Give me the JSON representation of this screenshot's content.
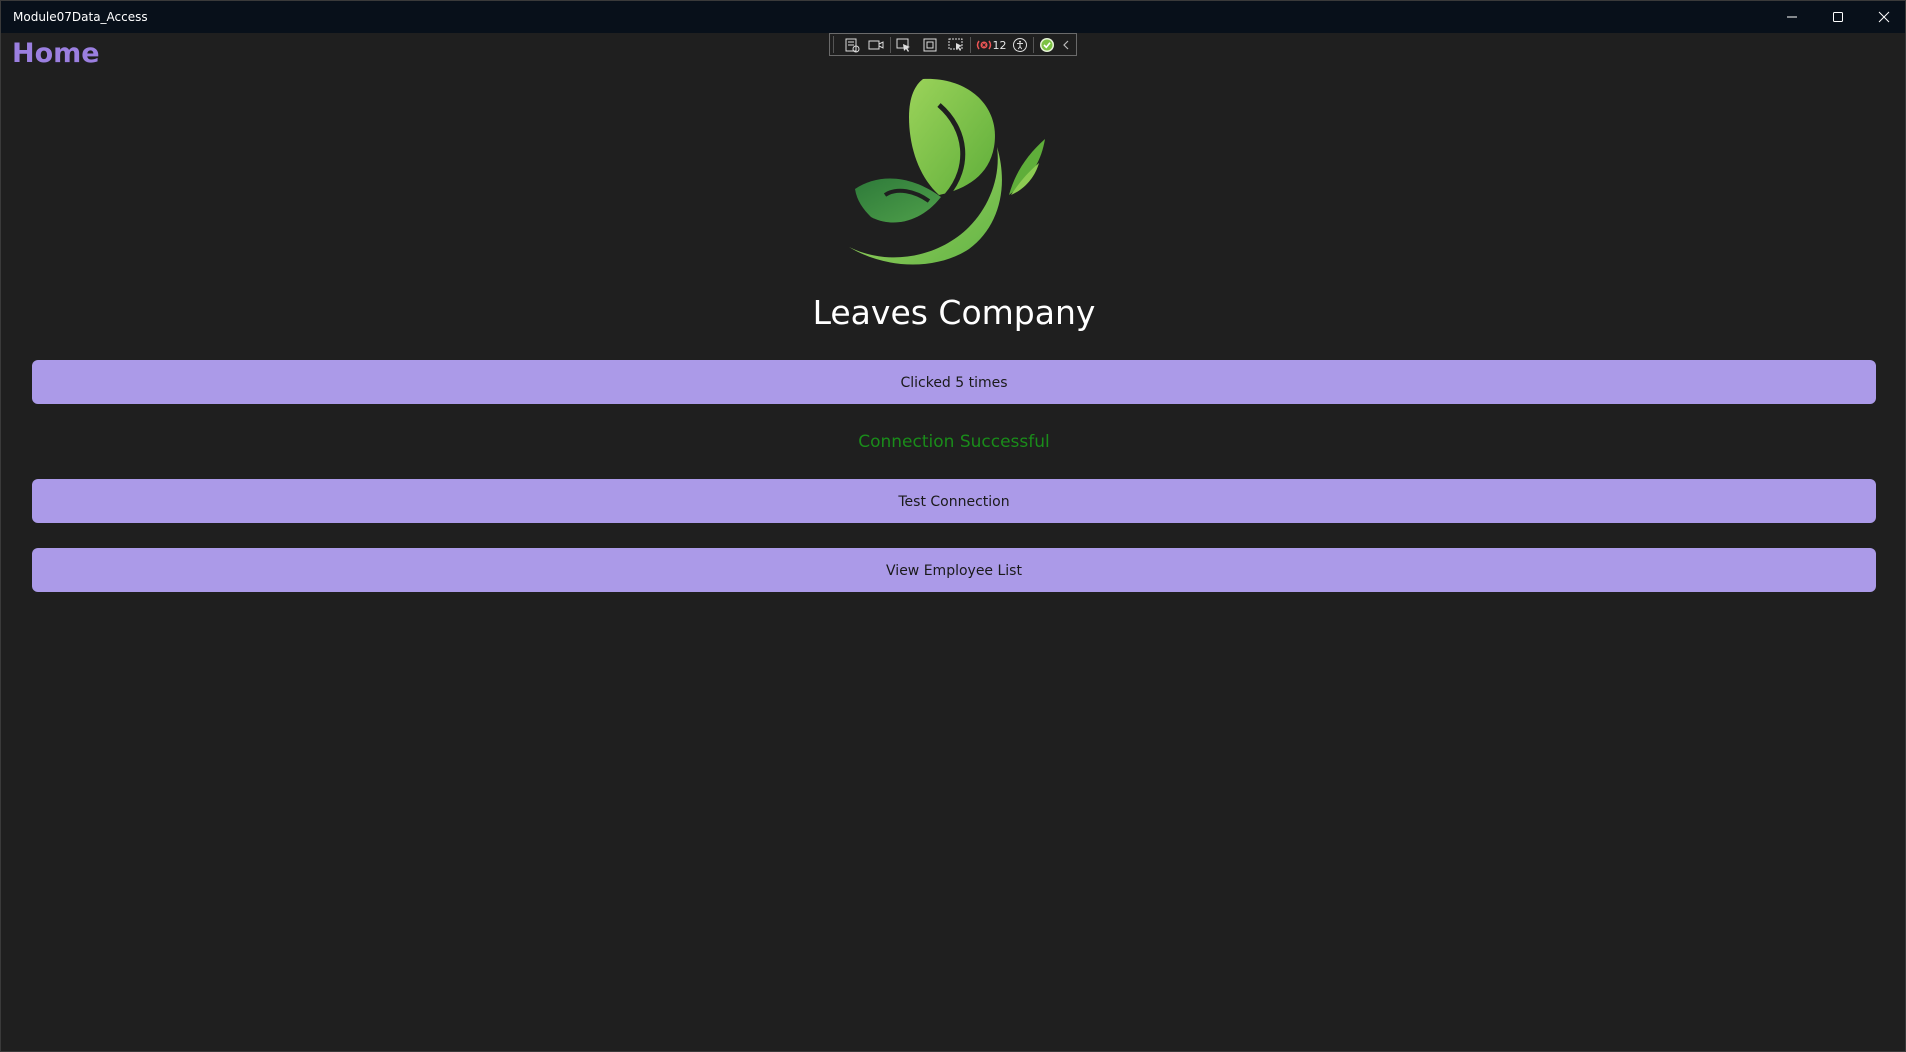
{
  "window": {
    "title": "Module07Data_Access",
    "controls": {
      "minimize_icon": "minimize-icon",
      "maximize_icon": "maximize-icon",
      "close_icon": "close-icon"
    }
  },
  "page": {
    "heading": "Home"
  },
  "debug_toolbar": {
    "binding_failures_count": "12"
  },
  "brand": {
    "logo_icon": "leaf-logo",
    "company_name": "Leaves Company"
  },
  "buttons": {
    "counter_label": "Clicked 5 times",
    "test_connection_label": "Test Connection",
    "view_employees_label": "View Employee List"
  },
  "status": {
    "connection_message": "Connection Successful"
  },
  "colors": {
    "background": "#1f1f1f",
    "titlebar": "#08101a",
    "accent": "#9b7fe0",
    "button": "#ab9ae8",
    "success": "#1a8c1a"
  }
}
